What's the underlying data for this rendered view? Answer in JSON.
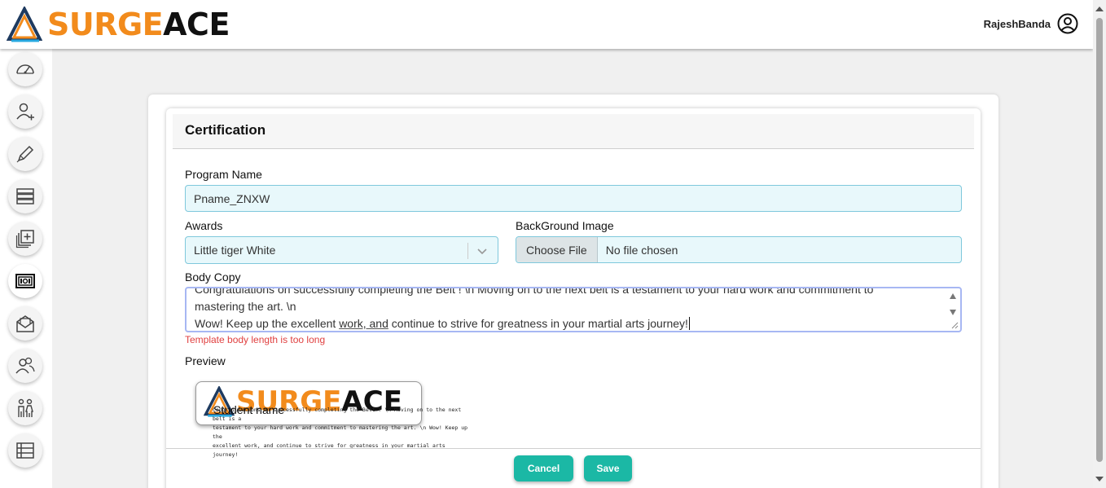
{
  "brand": {
    "name_part1": "SURGE",
    "name_part2": "ACE"
  },
  "user": {
    "name": "RajeshBanda",
    "icon": "user-circle-icon"
  },
  "sidebar": {
    "items": [
      {
        "icon": "dashboard-gauge-icon"
      },
      {
        "icon": "add-user-icon"
      },
      {
        "icon": "pen-icon"
      },
      {
        "icon": "list-rows-icon"
      },
      {
        "icon": "add-copy-icon"
      },
      {
        "icon": "certificate-icon"
      },
      {
        "icon": "mail-icon"
      },
      {
        "icon": "users-icon"
      },
      {
        "icon": "family-icon"
      },
      {
        "icon": "table-icon"
      }
    ]
  },
  "form": {
    "title": "Certification",
    "program_name_label": "Program Name",
    "program_name_value": "Pname_ZNXW",
    "awards_label": "Awards",
    "awards_value": "Little tiger White",
    "background_label": "BackGround Image",
    "choose_file_label": "Choose File",
    "file_status": "No file chosen",
    "body_copy_label": "Body Copy",
    "body_line1": "Congratulations on successfully completing the Belt ! \\n Moving on to the next belt is a testament to your hard work and commitment to",
    "body_line2": "mastering the art. \\n",
    "body_line3_a": "Wow! Keep up the excellent ",
    "body_line3_b": "work, and",
    "body_line3_c": " continue to strive for greatness in your martial arts journey!",
    "error_text": "Template body length is too long",
    "preview_label": "Preview",
    "preview_student": "Student name",
    "preview_body_line1": "Congratulations on successfully completing the Belt ! \\n Moving on to the next belt is a",
    "preview_body_line2": "testament to your hard work and commitment to mastering the art. \\n Wow! Keep up the",
    "preview_body_line3": "excellent work, and continue to strive for greatness in your martial arts journey!",
    "cancel_label": "Cancel",
    "save_label": "Save"
  },
  "colors": {
    "accent": "#1bb8a5",
    "brand_orange": "#f28b1c",
    "error": "#e04040"
  }
}
